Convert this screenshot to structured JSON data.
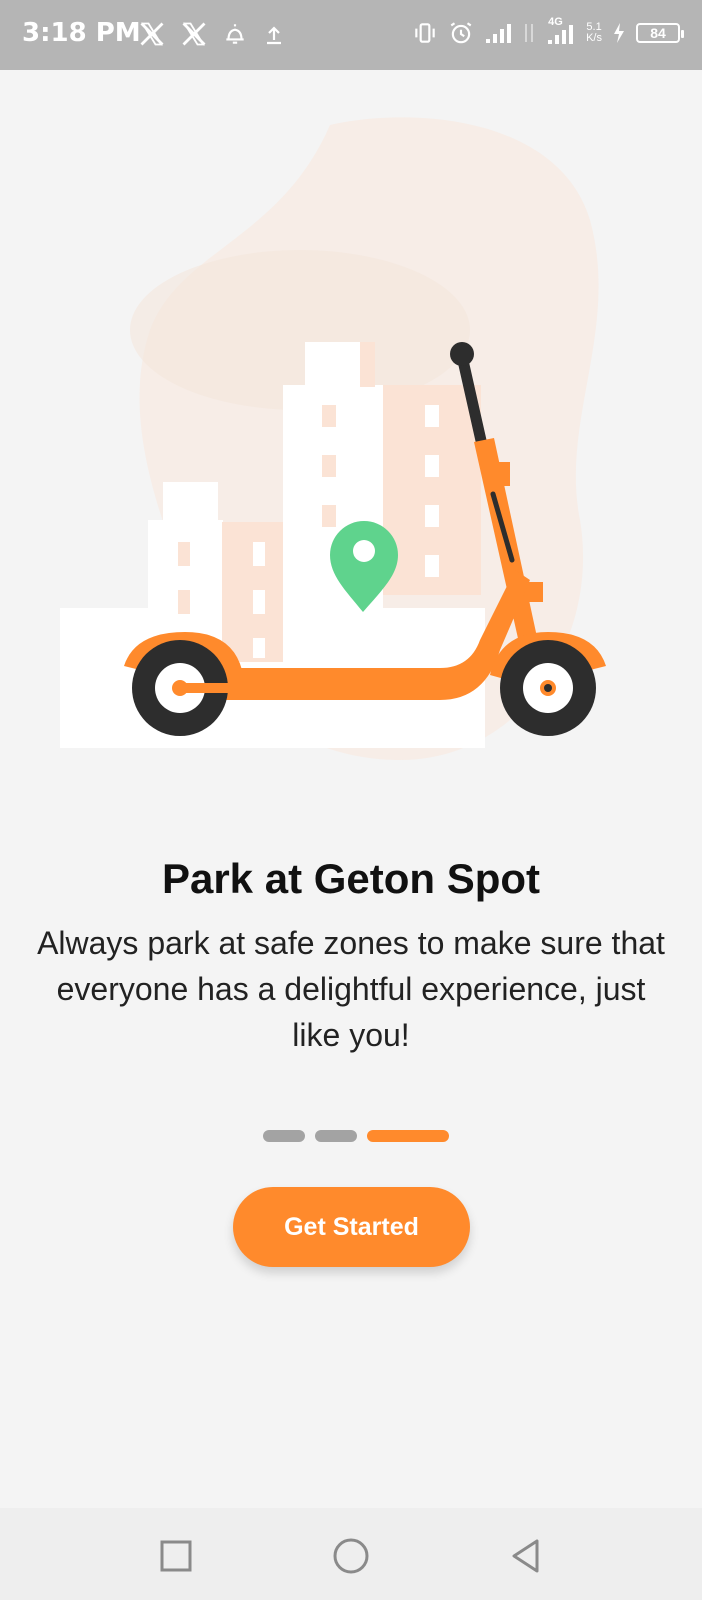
{
  "status_bar": {
    "time": "3:18 PM",
    "left_icons": [
      "x-icon",
      "x-icon",
      "notification-bell-icon",
      "upload-icon"
    ],
    "right_icons": [
      "vibrate-icon",
      "alarm-icon",
      "signal-icon",
      "data-arrows-icon",
      "4g-signal-icon"
    ],
    "network_type": "4G",
    "net_speed_value": "5.1",
    "net_speed_unit": "K/s",
    "battery_level": "84"
  },
  "onboarding": {
    "illustration": "scooter-city-location-pin",
    "title": "Park at Geton Spot",
    "description": "Always park at safe zones to make sure that everyone has a delightful experience, just like you!",
    "page_count": 3,
    "active_page": 3,
    "cta_label": "Get Started"
  },
  "colors": {
    "accent": "#ff8a2c",
    "pin": "#5fd38d",
    "indicator_inactive": "#a3a3a3"
  },
  "nav_bar": {
    "buttons": [
      "recents-icon",
      "home-icon",
      "back-icon"
    ]
  }
}
